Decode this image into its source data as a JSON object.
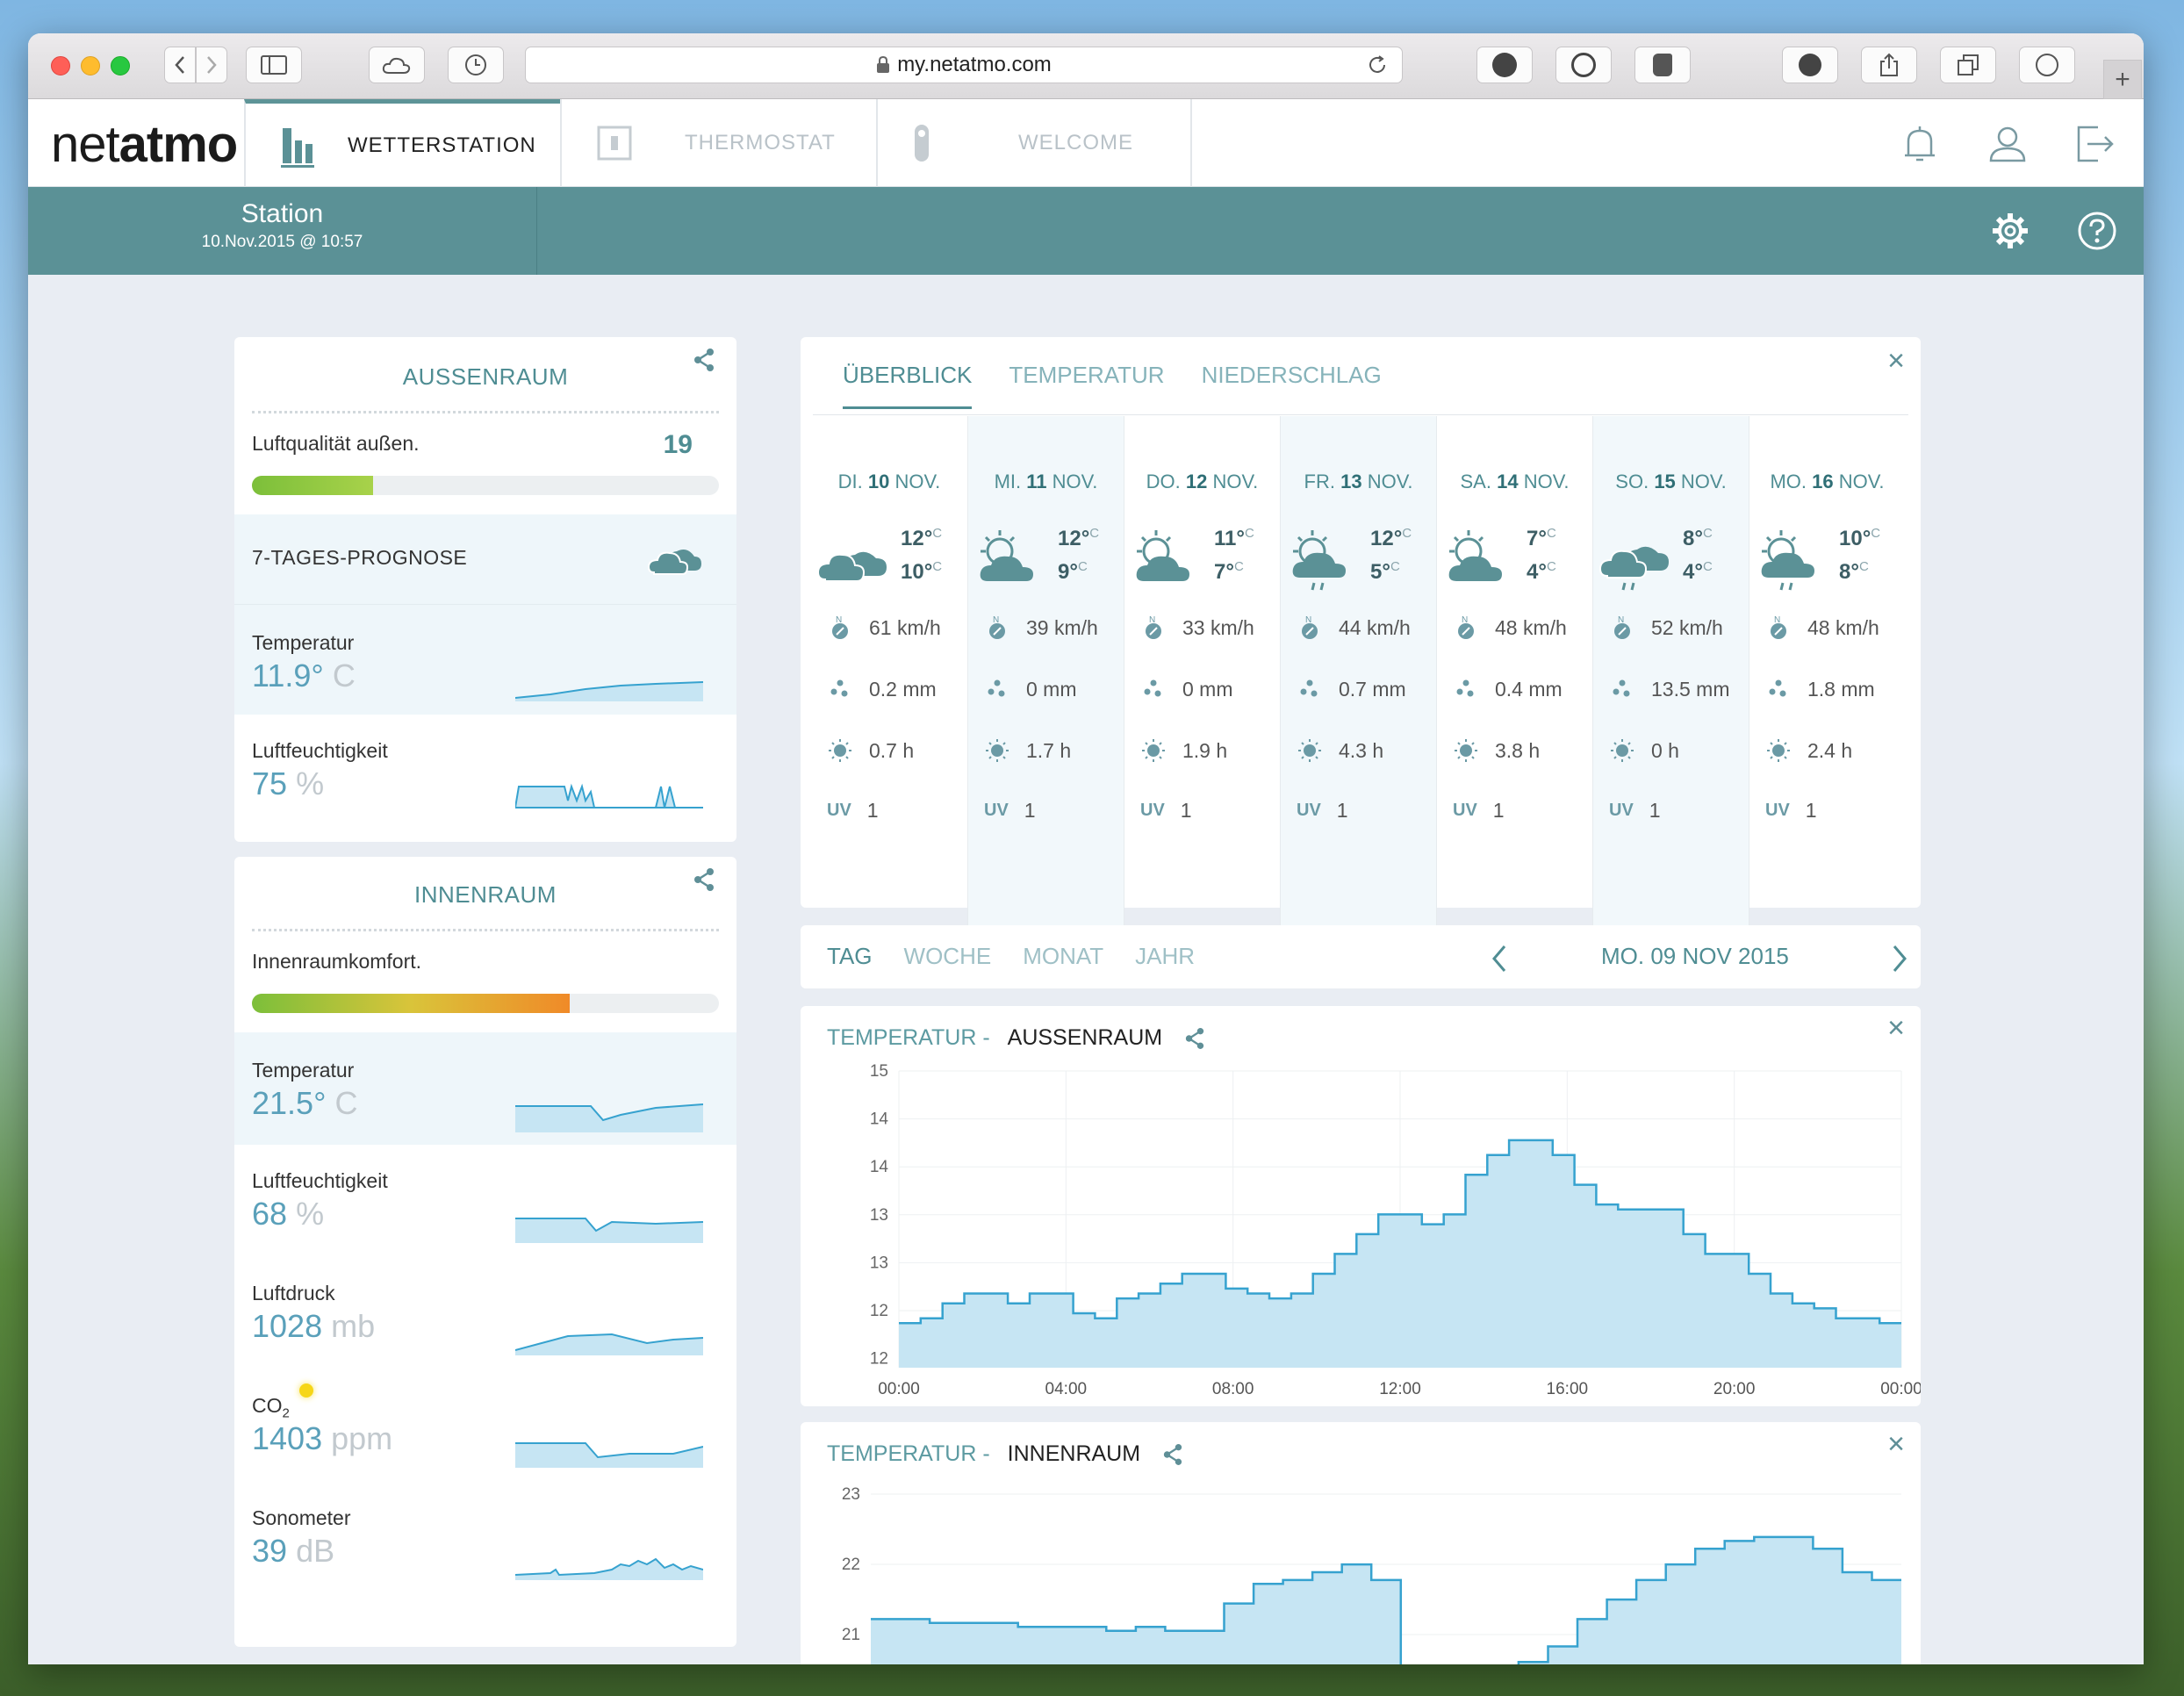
{
  "browser": {
    "url": "my.netatmo.com"
  },
  "nav": {
    "logo_a": "net",
    "logo_b": "atmo",
    "tabs": [
      {
        "label": "WETTERSTATION"
      },
      {
        "label": "THERMOSTAT"
      },
      {
        "label": "WELCOME"
      }
    ]
  },
  "station": {
    "name": "Station",
    "timestamp": "10.Nov.2015 @ 10:57"
  },
  "outdoor": {
    "title": "AUSSENRAUM",
    "air_quality_label": "Luftqualität außen.",
    "air_quality_value": "19",
    "air_quality_fraction": 0.26,
    "forecast_label": "7-TAGES-PROGNOSE",
    "temp_label": "Temperatur",
    "temp_value": "11.9°",
    "temp_unit": "C",
    "humidity_label": "Luftfeuchtigkeit",
    "humidity_value": "75",
    "humidity_unit": "%"
  },
  "indoor": {
    "title": "INNENRAUM",
    "comfort_label": "Innenraumkomfort.",
    "comfort_fraction": 0.68,
    "temp_label": "Temperatur",
    "temp_value": "21.5°",
    "temp_unit": "C",
    "humidity_label": "Luftfeuchtigkeit",
    "humidity_value": "68",
    "humidity_unit": "%",
    "pressure_label": "Luftdruck",
    "pressure_value": "1028",
    "pressure_unit": "mb",
    "co2_label": "CO",
    "co2_sub": "2",
    "co2_value": "1403",
    "co2_unit": "ppm",
    "noise_label": "Sonometer",
    "noise_value": "39",
    "noise_unit": "dB"
  },
  "forecast": {
    "tabs": [
      {
        "label": "ÜBERBLICK"
      },
      {
        "label": "TEMPERATUR"
      },
      {
        "label": "NIEDERSCHLAG"
      }
    ],
    "days": [
      {
        "dow": "DI.",
        "day": "10",
        "mon": "NOV.",
        "hi": "12°",
        "lo": "10°",
        "wind": "61 km/h",
        "rain": "0.2 mm",
        "sun": "0.7 h",
        "uv": "1",
        "icon": "cloud-icon"
      },
      {
        "dow": "MI.",
        "day": "11",
        "mon": "NOV.",
        "hi": "12°",
        "lo": "9°",
        "wind": "39 km/h",
        "rain": "0 mm",
        "sun": "1.7 h",
        "uv": "1",
        "icon": "partly-cloudy-icon"
      },
      {
        "dow": "DO.",
        "day": "12",
        "mon": "NOV.",
        "hi": "11°",
        "lo": "7°",
        "wind": "33 km/h",
        "rain": "0 mm",
        "sun": "1.9 h",
        "uv": "1",
        "icon": "partly-cloudy-icon"
      },
      {
        "dow": "FR.",
        "day": "13",
        "mon": "NOV.",
        "hi": "12°",
        "lo": "5°",
        "wind": "44 km/h",
        "rain": "0.7 mm",
        "sun": "4.3 h",
        "uv": "1",
        "icon": "sun-rain-icon"
      },
      {
        "dow": "SA.",
        "day": "14",
        "mon": "NOV.",
        "hi": "7°",
        "lo": "4°",
        "wind": "48 km/h",
        "rain": "0.4 mm",
        "sun": "3.8 h",
        "uv": "1",
        "icon": "partly-cloudy-icon"
      },
      {
        "dow": "SO.",
        "day": "15",
        "mon": "NOV.",
        "hi": "8°",
        "lo": "4°",
        "wind": "52 km/h",
        "rain": "13.5 mm",
        "sun": "0 h",
        "uv": "1",
        "icon": "cloud-rain-icon"
      },
      {
        "dow": "MO.",
        "day": "16",
        "mon": "NOV.",
        "hi": "10°",
        "lo": "8°",
        "wind": "48 km/h",
        "rain": "1.8 mm",
        "sun": "2.4 h",
        "uv": "1",
        "icon": "sun-rain-icon"
      }
    ],
    "unit_c": "C",
    "uv_label": "UV",
    "wind_letter": "N"
  },
  "range": {
    "tabs": [
      {
        "label": "TAG"
      },
      {
        "label": "WOCHE"
      },
      {
        "label": "MONAT"
      },
      {
        "label": "JAHR"
      }
    ],
    "date": "MO. 09 NOV 2015"
  },
  "chart_outdoor": {
    "title_a": "TEMPERATUR -",
    "title_b": "AUSSENRAUM"
  },
  "chart_indoor": {
    "title_a": "TEMPERATUR -",
    "title_b": "INNENRAUM"
  },
  "chart_data": [
    {
      "type": "area",
      "title": "TEMPERATUR - AUSSENRAUM",
      "x": [
        "00:00",
        "04:00",
        "08:00",
        "12:00",
        "16:00",
        "20:00",
        "00:00"
      ],
      "ytick_labels": [
        "15",
        "14",
        "14",
        "13",
        "13",
        "12",
        "12"
      ],
      "ylim": [
        11.75,
        14.75
      ],
      "values": [
        12.2,
        12.25,
        12.4,
        12.5,
        12.5,
        12.4,
        12.5,
        12.5,
        12.3,
        12.25,
        12.45,
        12.5,
        12.6,
        12.7,
        12.7,
        12.55,
        12.5,
        12.45,
        12.5,
        12.7,
        12.9,
        13.1,
        13.3,
        13.3,
        13.2,
        13.3,
        13.7,
        13.9,
        14.05,
        14.05,
        13.9,
        13.6,
        13.4,
        13.35,
        13.35,
        13.35,
        13.1,
        12.9,
        12.9,
        12.7,
        12.5,
        12.4,
        12.35,
        12.25,
        12.25,
        12.2
      ]
    },
    {
      "type": "area",
      "title": "TEMPERATUR - INNENRAUM",
      "ytick_labels": [
        "23",
        "22",
        "21"
      ],
      "ylim": [
        20.55,
        23.0
      ],
      "values": [
        21.4,
        21.4,
        21.35,
        21.35,
        21.35,
        21.3,
        21.3,
        21.3,
        21.25,
        21.3,
        21.25,
        21.25,
        21.6,
        21.85,
        21.9,
        22.0,
        22.1,
        21.9,
        20.6,
        20.6,
        20.6,
        20.75,
        20.85,
        21.05,
        21.4,
        21.65,
        21.9,
        22.1,
        22.3,
        22.4,
        22.45,
        22.45,
        22.3,
        22.0,
        21.9
      ]
    }
  ],
  "colors": {
    "teal": "#5b9196",
    "accent": "#4f8d93",
    "chart_fill": "#c6e5f3",
    "chart_line": "#36a2cf"
  }
}
